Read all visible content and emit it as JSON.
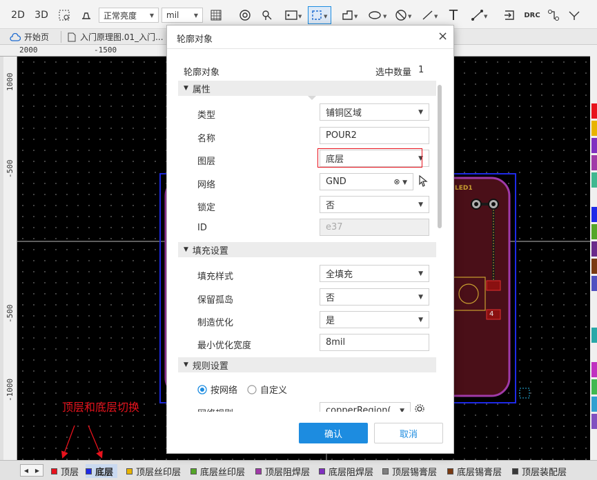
{
  "toolbar": {
    "mode_2d": "2D",
    "mode_3d": "3D",
    "brightness": "正常亮度",
    "unit": "mil",
    "drc": "DRC"
  },
  "tabs": [
    {
      "label": "开始页"
    },
    {
      "label": "入门原理图.01_入门..."
    }
  ],
  "ruler": {
    "h": [
      "2000",
      "-1500"
    ],
    "v": [
      "1000",
      "-500",
      "-500",
      "-1000"
    ]
  },
  "pcb": {
    "designator": "LED1",
    "pad_number": "4"
  },
  "dialog": {
    "title": "轮廓对象",
    "header_left": "轮廓对象",
    "selected_label": "选中数量",
    "selected_count": "1",
    "section_properties": "属性",
    "type_label": "类型",
    "type_value": "铺铜区域",
    "name_label": "名称",
    "name_value": "POUR2",
    "layer_label": "图层",
    "layer_value": "底层",
    "net_label": "网络",
    "net_value": "GND",
    "lock_label": "锁定",
    "lock_value": "否",
    "id_label": "ID",
    "id_value": "e37",
    "section_fill": "填充设置",
    "fill_style_label": "填充样式",
    "fill_style_value": "全填充",
    "keep_island_label": "保留孤岛",
    "keep_island_value": "否",
    "mfg_opt_label": "制造优化",
    "mfg_opt_value": "是",
    "min_width_label": "最小优化宽度",
    "min_width_value": "8mil",
    "section_rules": "规则设置",
    "radio_by_net": "按网络",
    "radio_custom": "自定义",
    "net_rule_label": "网络规则",
    "net_rule_value": "copperRegion(",
    "confirm": "确认",
    "cancel": "取消"
  },
  "annotation": {
    "text": "顶层和底层切换"
  },
  "layers": [
    {
      "label": "顶层",
      "color": "#e8121c"
    },
    {
      "label": "底层",
      "color": "#1e2ae8"
    },
    {
      "label": "顶层丝印层",
      "color": "#e8b400"
    },
    {
      "label": "底层丝印层",
      "color": "#54a628"
    },
    {
      "label": "顶层阻焊层",
      "color": "#a03aa8"
    },
    {
      "label": "底层阻焊层",
      "color": "#8030c0"
    },
    {
      "label": "顶层锡膏层",
      "color": "#808080"
    },
    {
      "label": "底层锡膏层",
      "color": "#7a3a12"
    },
    {
      "label": "顶层装配层",
      "color": "#3a3a3a"
    }
  ],
  "colors": {
    "accent": "#1d8ce0",
    "annotation": "#e8121c",
    "board_outline": "#1e2ae8"
  }
}
